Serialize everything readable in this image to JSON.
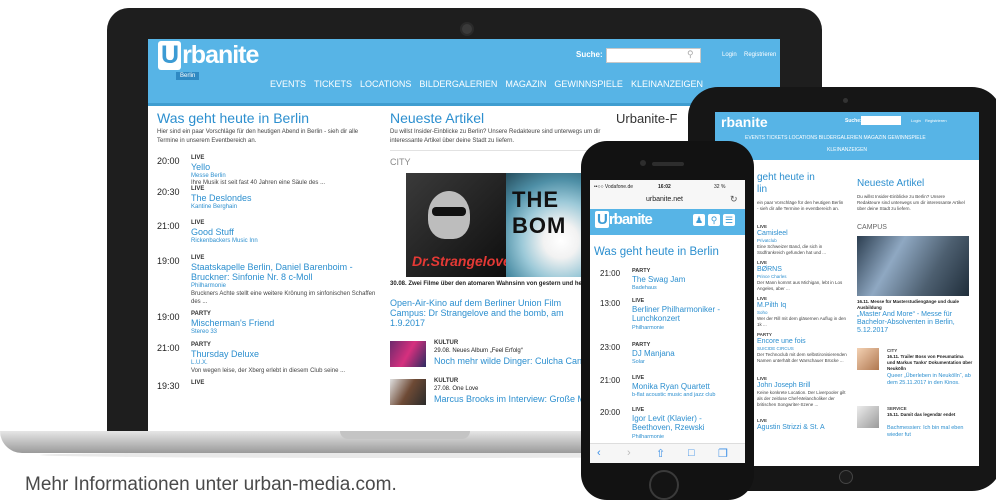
{
  "footer_text": "Mehr Informationen unter urban-media.com.",
  "laptop": {
    "logo_text": "rbanite",
    "logo_initial": "U",
    "logo_sub": "Berlin",
    "search_label": "Suche:",
    "login": "Login",
    "register": "Registrieren",
    "nav": [
      "EVENTS",
      "TICKETS",
      "LOCATIONS",
      "BILDERGALERIEN",
      "MAGAZIN",
      "GEWINNSPIELE",
      "KLEINANZEIGEN"
    ],
    "left": {
      "title": "Was geht heute in Berlin",
      "intro": "Hier sind ein paar Vorschläge für den heutigen Abend in Berlin - sieh dir alle Termine in unserem Eventbereich an.",
      "events": [
        {
          "time": "20:00",
          "cat": "LIVE",
          "title": "Yello",
          "loc": "Messe Berlin",
          "desc": "Ihre Musik ist seit fast 40 Jahren eine Säule des ..."
        },
        {
          "time": "20:30",
          "cat": "LIVE",
          "title": "The Deslondes",
          "loc": "Kantine Berghain",
          "desc": ""
        },
        {
          "time": "21:00",
          "cat": "LIVE",
          "title": "Good Stuff",
          "loc": "Rickenbackers Music Inn",
          "desc": ""
        },
        {
          "time": "19:00",
          "cat": "LIVE",
          "title": "Staatskapelle Berlin, Daniel Barenboim - Bruckner: Sinfonie Nr. 8 c-Moll",
          "loc": "Philharmonie",
          "desc": "Bruckners Achte stellt eine weitere Krönung im sinfonischen Schaffen des ..."
        },
        {
          "time": "19:00",
          "cat": "PARTY",
          "title": "Mischerman's Friend",
          "loc": "Stereo 33",
          "desc": ""
        },
        {
          "time": "21:00",
          "cat": "PARTY",
          "title": "Thursday Deluxe",
          "loc": "L.U.X.",
          "desc": "Von wegen leise, der Xberg erlebt in diesem Club seine ..."
        },
        {
          "time": "19:30",
          "cat": "LIVE",
          "title": "",
          "loc": "",
          "desc": ""
        }
      ]
    },
    "middle": {
      "title": "Neueste Artikel",
      "intro": "Du willst Insider-Einblicke zu Berlin? Unsere Redakteure sind unterwegs um dir interessante Artikel über deine Stadt zu liefern.",
      "section": "CITY",
      "poster_left": "Dr.Strangelove",
      "poster_right": "THE BOM",
      "article_meta": "30.08. Zwei Filme über den atomaren Wahnsinn von gestern und heute",
      "article_title": "Open-Air-Kino auf dem Berliner Union Film Campus: Dr Strangelove and the bomb, am 1.9.2017",
      "items": [
        {
          "cat": "KULTUR",
          "meta": "29.08. Neues Album „Feel Erfolg“",
          "title": "Noch mehr wilde Dinger: Culcha Candela"
        },
        {
          "cat": "KULTUR",
          "meta": "27.08. One Love",
          "title": "Marcus Brooks im Interview: Große Musik"
        }
      ]
    },
    "right": {
      "title": "Urbanite-F"
    }
  },
  "tablet": {
    "logo_text": "rbanite",
    "search_label": "Suche:",
    "login": "Login",
    "register": "Registrieren",
    "nav_line1": "EVENTS   TICKETS   LOCATIONS   BILDERGALERIEN   MAGAZIN   GEWINNSPIELE",
    "nav_line2": "KLEINANZEIGEN",
    "left_title": "geht heute in",
    "left_title2": "lin",
    "left_intro": "ein paar Vorschläge für den heutigen Berlin - sieh dir alle Termine in eventbereich an.",
    "left_events": [
      {
        "cat": "LIVE",
        "title": "Camisleel",
        "loc": "Privatclub",
        "desc": "Eine Schweizer Band, die sich in Südfrankreich gefunden hat und ..."
      },
      {
        "cat": "LIVE",
        "title": "BØRNS",
        "loc": "Prince Charles",
        "desc": "Der Mann kommt aus Michigan, lebt in Los Angeles, aber ..."
      },
      {
        "cat": "LIVE",
        "title": "M.Pilth Iq",
        "loc": "Soho",
        "desc": "Wer der Rill mit dem gläsernen Auflug in den 1k ..."
      },
      {
        "cat": "PARTY",
        "title": "Encore une fois",
        "loc": "SUICIDE CIRCUS",
        "desc": "Der Technoclub mit dem selbstironisierenden Namen unterhält der Warschauer Brücke ..."
      },
      {
        "cat": "LIVE",
        "title": "John Joseph Brill",
        "loc": "",
        "desc": "Keine konkrete Location. Der Liverpooler gilt als der zeitlose Chef-Melancholiker der britischen Songwriter-Szene ..."
      },
      {
        "cat": "LIVE",
        "title": "Agustin Strizzi & St. A",
        "loc": "",
        "desc": ""
      }
    ],
    "right_title": "Neueste Artikel",
    "right_intro": "Du willst Insider-Einblicke zu Berlin? Unsere Redakteure sind unterwegs um dir interessante Artikel über deine Stadt zu liefern.",
    "right_section": "CAMPUS",
    "right_meta": "16.11. Messe für Masterstudiengänge und duale Ausbildung",
    "right_article": "„Master And More“ - Messe für Bachelor-Absolventen in Berlin, 5.12.2017",
    "items": [
      {
        "cat": "CITY",
        "meta": "16.11. Trailer Boss von Pneumatima und Markus Tanks' Dokumentation über Neukölln",
        "title": "Queer „Überleben in Neukölln“, ab dem 25.11.2017 in den Kinos."
      },
      {
        "cat": "SERVICE",
        "meta": "15.11. Damit das legendär endet",
        "title": "Bachmessien: Ich bin mal eben wieder fut"
      }
    ]
  },
  "phone": {
    "carrier": "••○○ Vodafone.de",
    "time": "16:02",
    "battery": "32 %",
    "url": "urbanite.net",
    "logo_text": "rbanite",
    "title": "Was geht heute in Berlin",
    "events": [
      {
        "time": "21:00",
        "cat": "PARTY",
        "title": "The Swag Jam",
        "loc": "Badehaus"
      },
      {
        "time": "13:00",
        "cat": "LIVE",
        "title": "Berliner Philharmoniker - Lunchkonzert",
        "loc": "Philharmonie"
      },
      {
        "time": "23:00",
        "cat": "PARTY",
        "title": "DJ Manjana",
        "loc": "Solar"
      },
      {
        "time": "21:00",
        "cat": "LIVE",
        "title": "Monika Ryan Quartett",
        "loc": "b-flat acoustic music and jazz club"
      },
      {
        "time": "20:00",
        "cat": "LIVE",
        "title": "Igor Levit (Klavier) - Beethoven, Rzewski",
        "loc": "Philharmonie"
      }
    ]
  }
}
